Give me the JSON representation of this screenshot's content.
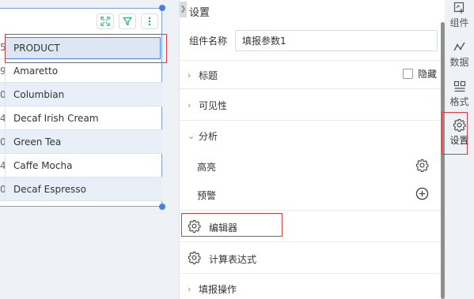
{
  "table": {
    "header": "PRODUCT",
    "header_index": "5",
    "rows": [
      {
        "index": "9",
        "value": "Amaretto"
      },
      {
        "index": "0",
        "value": "Columbian"
      },
      {
        "index": "4",
        "value": "Decaf Irish Cream"
      },
      {
        "index": "0",
        "value": "Green Tea"
      },
      {
        "index": "4",
        "value": "Caffe Mocha"
      },
      {
        "index": "0",
        "value": "Decaf Espresso"
      }
    ]
  },
  "toolbar": {
    "icons": [
      "expand-icon",
      "filter-icon",
      "more-vertical-icon"
    ]
  },
  "panel": {
    "title": "设置",
    "component_name_label": "组件名称",
    "component_name_value": "填报参数1",
    "sections": {
      "title": "标题",
      "hide": "隐藏",
      "visibility": "可见性",
      "analysis": "分析",
      "highlight": "高亮",
      "alert": "预警",
      "editor": "编辑器",
      "expression": "计算表达式",
      "fill_action": "填报操作"
    }
  },
  "tabs": {
    "component": "组件",
    "data": "数据",
    "format": "格式",
    "settings": "设置"
  },
  "colors": {
    "accent": "#4a7fe0",
    "highlight_box": "#e0393e",
    "toolbar_green": "#2bb673"
  }
}
